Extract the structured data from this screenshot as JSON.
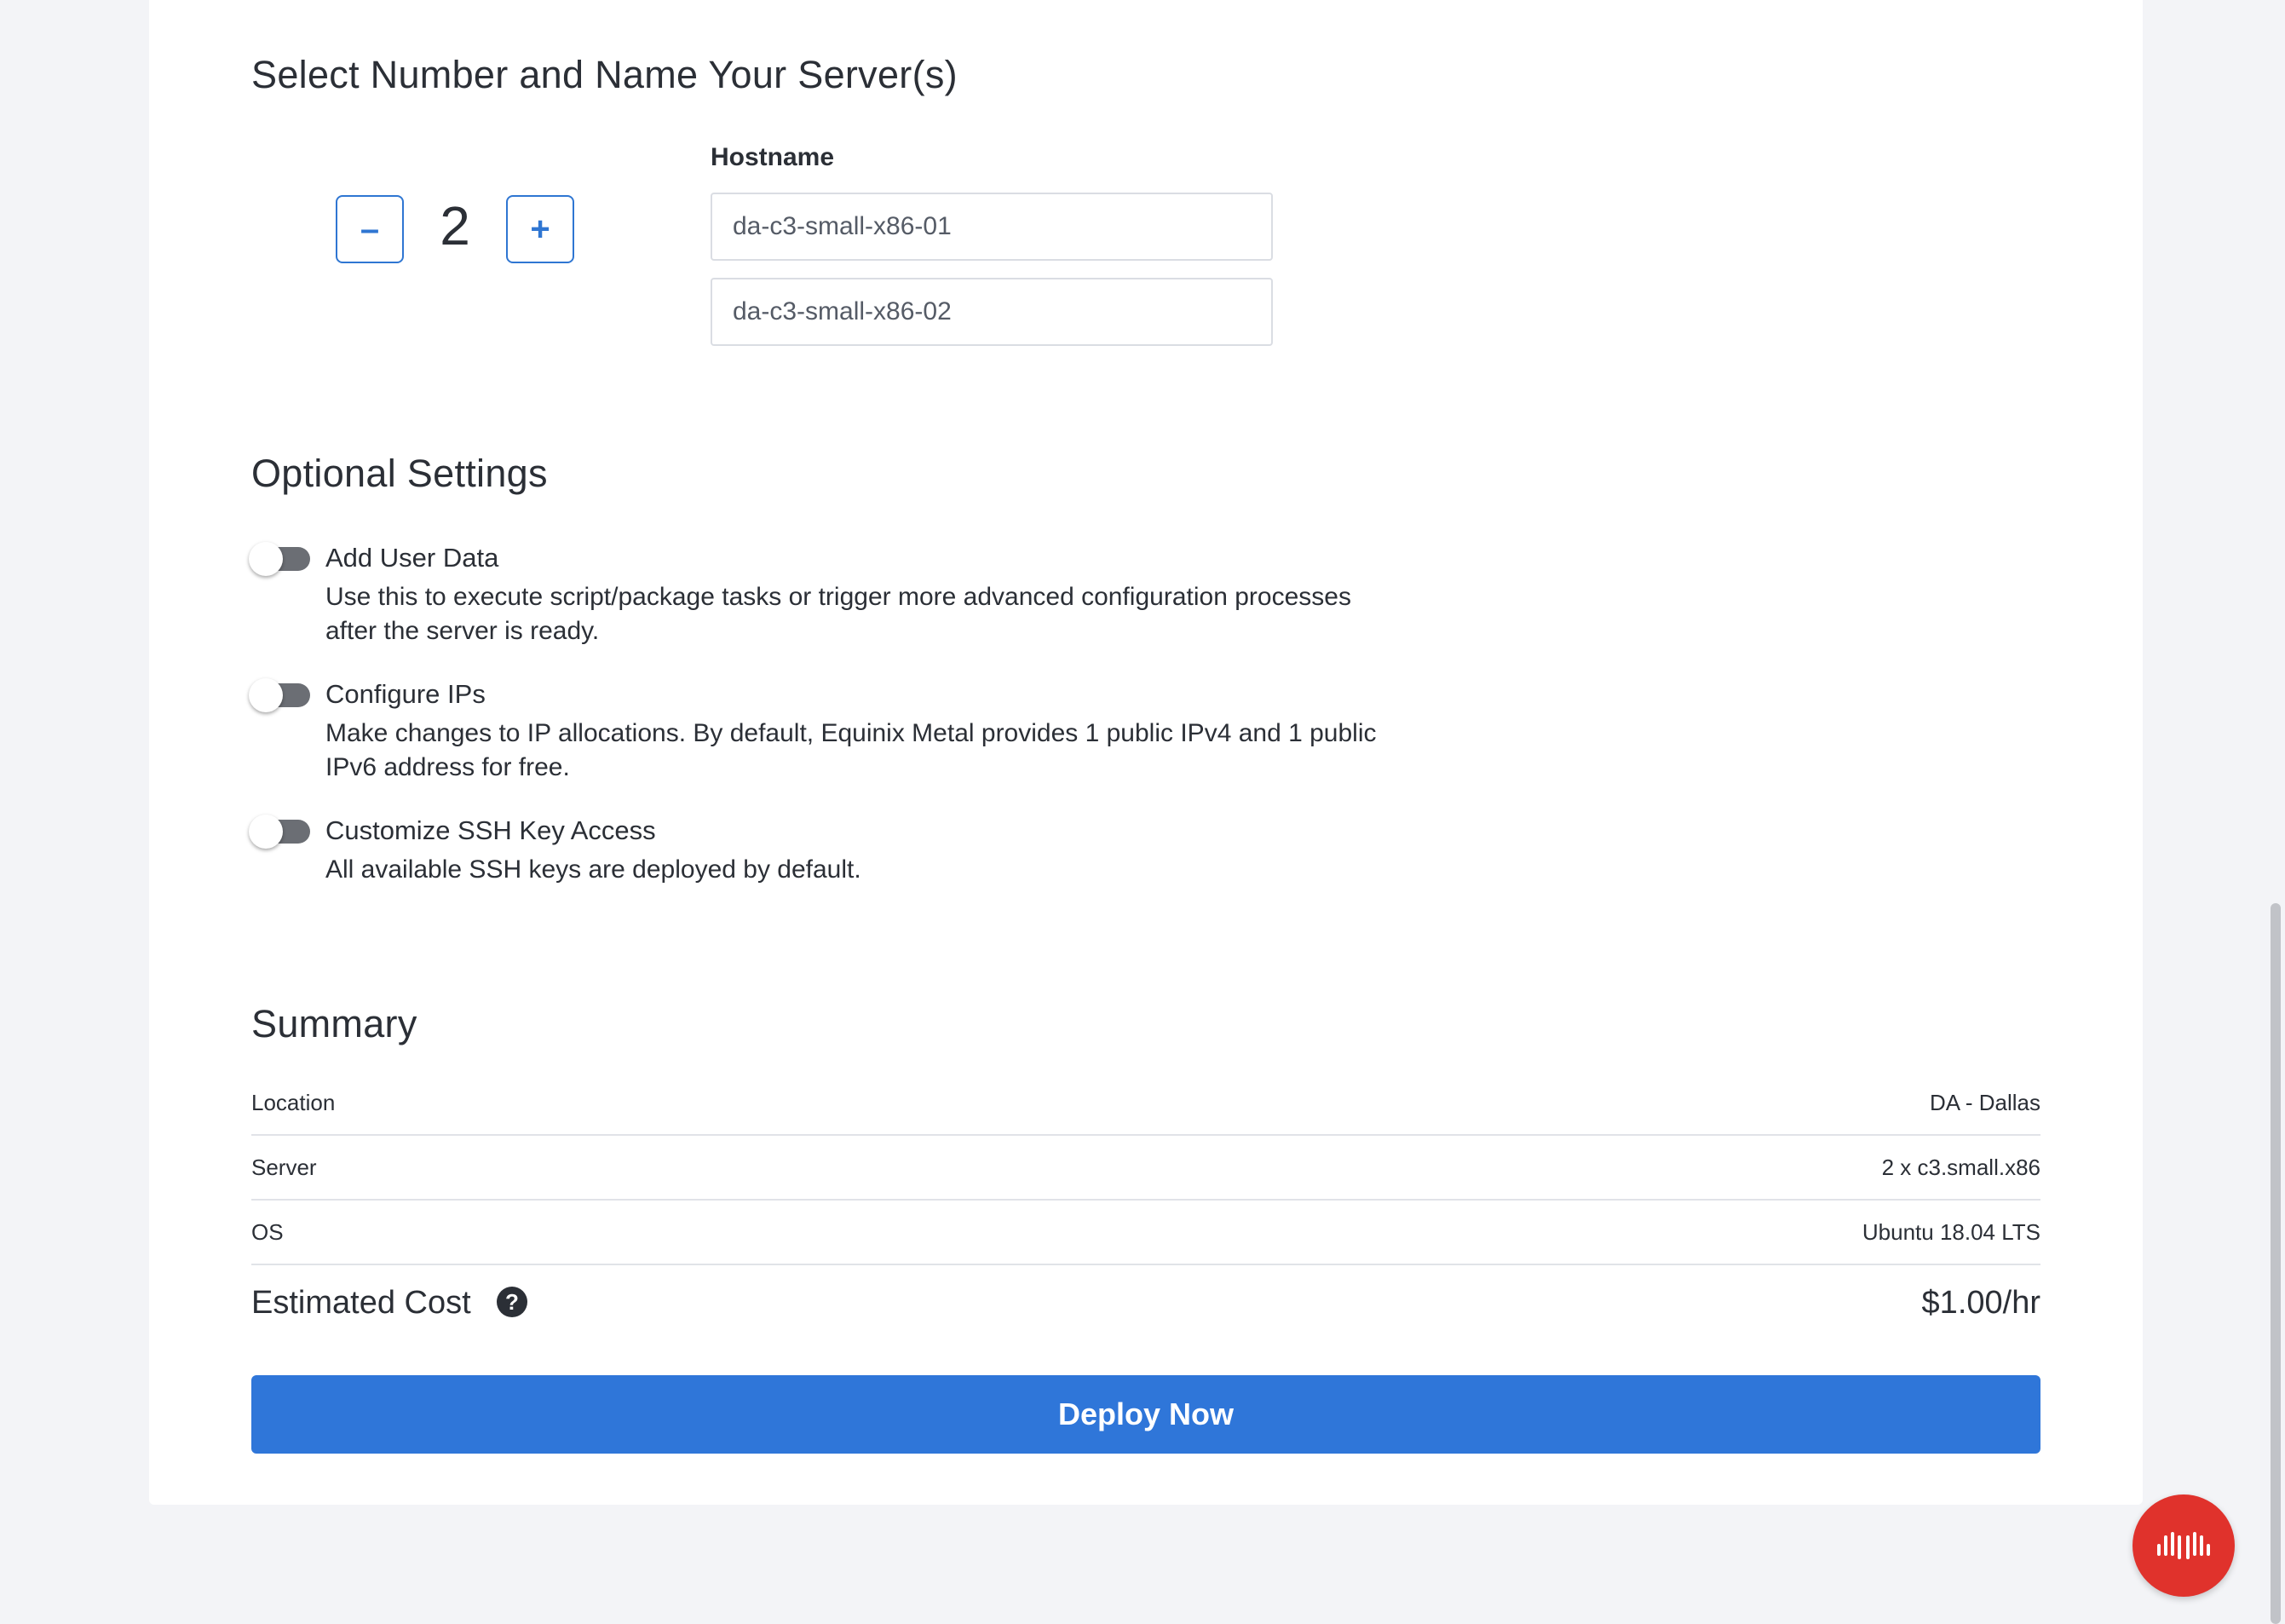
{
  "servers": {
    "title": "Select Number and Name Your Server(s)",
    "count": "2",
    "decrement_label": "–",
    "increment_label": "+",
    "hostname_label": "Hostname",
    "hostnames": [
      "da-c3-small-x86-01",
      "da-c3-small-x86-02"
    ]
  },
  "optional": {
    "title": "Optional Settings",
    "items": [
      {
        "title": "Add User Data",
        "desc_line1": "Use this to execute script/package tasks or trigger more advanced configuration processes",
        "desc_line2": "after the server is ready.",
        "enabled": false
      },
      {
        "title": "Configure IPs",
        "desc_line1": "Make changes to IP allocations. By default, Equinix Metal provides 1 public IPv4 and 1 public",
        "desc_line2": "IPv6 address for free.",
        "enabled": false
      },
      {
        "title": "Customize SSH Key Access",
        "desc_line1": "All available SSH keys are deployed by default.",
        "enabled": false
      }
    ]
  },
  "summary": {
    "title": "Summary",
    "rows": [
      {
        "key": "Location",
        "value": "DA - Dallas"
      },
      {
        "key": "Server",
        "value": "2 x c3.small.x86"
      },
      {
        "key": "OS",
        "value": "Ubuntu 18.04 LTS"
      }
    ],
    "cost_label": "Estimated Cost",
    "cost_help_icon": "question-circle-icon",
    "cost_value": "$1.00/hr",
    "deploy_label": "Deploy Now"
  },
  "colors": {
    "accent": "#2f76d9",
    "fab": "#e0322c",
    "toggle_off": "#6b6e74"
  },
  "fab": {
    "icon": "equinix-logo-icon"
  }
}
